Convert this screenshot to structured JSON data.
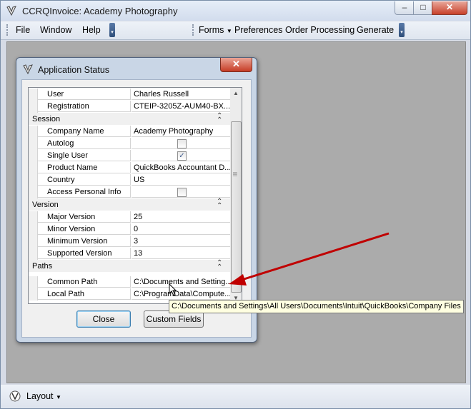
{
  "window": {
    "title": "CCRQInvoice: Academy Photography",
    "min": "–",
    "max": "□",
    "close": "✕"
  },
  "menubar": {
    "file": "File",
    "window": "Window",
    "help": "Help",
    "forms": "Forms",
    "preferences": "Preferences",
    "order_processing": "Order Processing",
    "generate": "Generate"
  },
  "statusbar": {
    "layout": "Layout"
  },
  "dialog": {
    "title": "Application Status",
    "close_glyph": "✕",
    "close_button": "Close",
    "custom_fields_button": "Custom Fields",
    "tooltip": "C:\\Documents and Settings\\All Users\\Documents\\Intuit\\QuickBooks\\Company Files",
    "rows": {
      "user": {
        "name": "User",
        "value": "Charles Russell"
      },
      "registration": {
        "name": "Registration",
        "value": "CTEIP-3205Z-AUM40-BX..."
      },
      "session_header": "Session",
      "company_name": {
        "name": "Company Name",
        "value": "Academy Photography"
      },
      "autolog": {
        "name": "Autolog",
        "checked": false
      },
      "single_user": {
        "name": "Single User",
        "checked": true
      },
      "product_name": {
        "name": "Product Name",
        "value": "QuickBooks Accountant D..."
      },
      "country": {
        "name": "Country",
        "value": "US"
      },
      "access_personal_info": {
        "name": "Access Personal Info",
        "checked": false
      },
      "version_header": "Version",
      "major_version": {
        "name": "Major Version",
        "value": "25"
      },
      "minor_version": {
        "name": "Minor Version",
        "value": "0"
      },
      "minimum_version": {
        "name": "Minimum Version",
        "value": "3"
      },
      "supported_version": {
        "name": "Supported Version",
        "value": "13"
      },
      "paths_header": "Paths",
      "common_path": {
        "name": "Common Path",
        "value": "C:\\Documents and Setting..."
      },
      "local_path": {
        "name": "Local Path",
        "value": "C:\\ProgramData\\Compute..."
      }
    }
  },
  "colors": {
    "annotation_arrow": "#c00000",
    "tooltip_bg": "#ffffe1",
    "workspace": "#ababab"
  }
}
